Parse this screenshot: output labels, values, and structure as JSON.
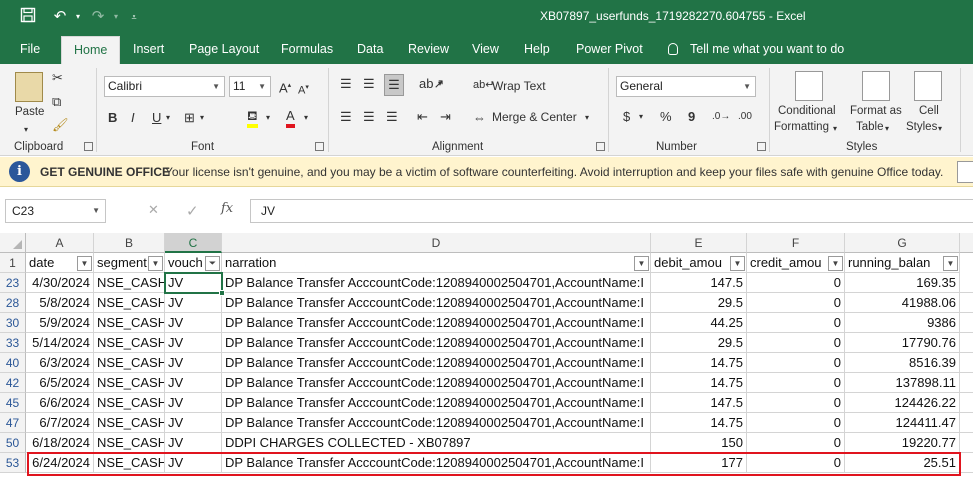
{
  "window": {
    "title": "XB07897_userfunds_1719282270.604755  -  Excel"
  },
  "tabs": [
    "File",
    "Home",
    "Insert",
    "Page Layout",
    "Formulas",
    "Data",
    "Review",
    "View",
    "Help",
    "Power Pivot"
  ],
  "active_tab": "Home",
  "tell_me": "Tell me what you want to do",
  "ribbon": {
    "clipboard": {
      "label": "Clipboard",
      "paste": "Paste"
    },
    "font": {
      "label": "Font",
      "font_name": "Calibri",
      "font_size": "11",
      "bold": "B",
      "italic": "I",
      "underline": "U"
    },
    "alignment": {
      "label": "Alignment",
      "wrap_text": "Wrap Text",
      "merge_center": "Merge & Center"
    },
    "number": {
      "label": "Number",
      "format": "General",
      "currency": "$",
      "percent": "%",
      "comma": "9"
    },
    "styles": {
      "label": "Styles",
      "conditional_1": "Conditional",
      "conditional_2": "Formatting",
      "format_table_1": "Format as",
      "format_table_2": "Table",
      "cell_styles_1": "Cell",
      "cell_styles_2": "Styles"
    }
  },
  "license_bar": {
    "title": "GET GENUINE OFFICE",
    "message": "Your license isn't genuine, and you may be a victim of software counterfeiting. Avoid interruption and keep your files safe with genuine Office today."
  },
  "formula_bar": {
    "name_box": "C23",
    "cancel": "✕",
    "enter": "✓",
    "fx": "fx",
    "value": "JV"
  },
  "sheet": {
    "columns": [
      "A",
      "B",
      "C",
      "D",
      "E",
      "F",
      "G"
    ],
    "selected_column": "C",
    "header_row_number": "1",
    "headers": [
      "date",
      "segment",
      "voucher",
      "narration",
      "debit_amount",
      "credit_amount",
      "running_balance"
    ],
    "header_visible": [
      "date",
      "segment",
      "vouch",
      "narration",
      "debit_amou",
      "credit_amou",
      "running_balan"
    ],
    "rows": [
      {
        "row": "23",
        "date": "4/30/2024",
        "segment": "NSE_CASH",
        "voucher": "JV",
        "narration": "DP Balance Transfer AcccountCode:1208940002504701,AccountName:I",
        "debit": "147.5",
        "credit": "0",
        "balance": "169.35"
      },
      {
        "row": "28",
        "date": "5/8/2024",
        "segment": "NSE_CASH",
        "voucher": "JV",
        "narration": "DP Balance Transfer AcccountCode:1208940002504701,AccountName:I",
        "debit": "29.5",
        "credit": "0",
        "balance": "41988.06"
      },
      {
        "row": "30",
        "date": "5/9/2024",
        "segment": "NSE_CASH",
        "voucher": "JV",
        "narration": "DP Balance Transfer AcccountCode:1208940002504701,AccountName:I",
        "debit": "44.25",
        "credit": "0",
        "balance": "9386"
      },
      {
        "row": "33",
        "date": "5/14/2024",
        "segment": "NSE_CASH",
        "voucher": "JV",
        "narration": "DP Balance Transfer AcccountCode:1208940002504701,AccountName:I",
        "debit": "29.5",
        "credit": "0",
        "balance": "17790.76"
      },
      {
        "row": "40",
        "date": "6/3/2024",
        "segment": "NSE_CASH",
        "voucher": "JV",
        "narration": "DP Balance Transfer AcccountCode:1208940002504701,AccountName:I",
        "debit": "14.75",
        "credit": "0",
        "balance": "8516.39"
      },
      {
        "row": "42",
        "date": "6/5/2024",
        "segment": "NSE_CASH",
        "voucher": "JV",
        "narration": "DP Balance Transfer AcccountCode:1208940002504701,AccountName:I",
        "debit": "14.75",
        "credit": "0",
        "balance": "137898.11"
      },
      {
        "row": "45",
        "date": "6/6/2024",
        "segment": "NSE_CASH",
        "voucher": "JV",
        "narration": "DP Balance Transfer AcccountCode:1208940002504701,AccountName:I",
        "debit": "147.5",
        "credit": "0",
        "balance": "124426.22"
      },
      {
        "row": "47",
        "date": "6/7/2024",
        "segment": "NSE_CASH",
        "voucher": "JV",
        "narration": "DP Balance Transfer AcccountCode:1208940002504701,AccountName:I",
        "debit": "14.75",
        "credit": "0",
        "balance": "124411.47"
      },
      {
        "row": "50",
        "date": "6/18/2024",
        "segment": "NSE_CASH",
        "voucher": "JV",
        "narration": " DDPI CHARGES COLLECTED - XB07897",
        "debit": "150",
        "credit": "0",
        "balance": "19220.77"
      },
      {
        "row": "53",
        "date": "6/24/2024",
        "segment": "NSE_CASH",
        "voucher": "JV",
        "narration": "DP Balance Transfer AcccountCode:1208940002504701,AccountName:I",
        "debit": "177",
        "credit": "0",
        "balance": "25.51"
      }
    ],
    "highlighted_row": "53"
  },
  "colors": {
    "excel_green": "#217346",
    "highlight_red": "#e0141e",
    "license_bg": "#fff4ce"
  },
  "icons": [
    "save-icon",
    "undo-icon",
    "redo-icon",
    "customize-icon",
    "lightbulb-icon",
    "info-icon",
    "filter-icon"
  ]
}
